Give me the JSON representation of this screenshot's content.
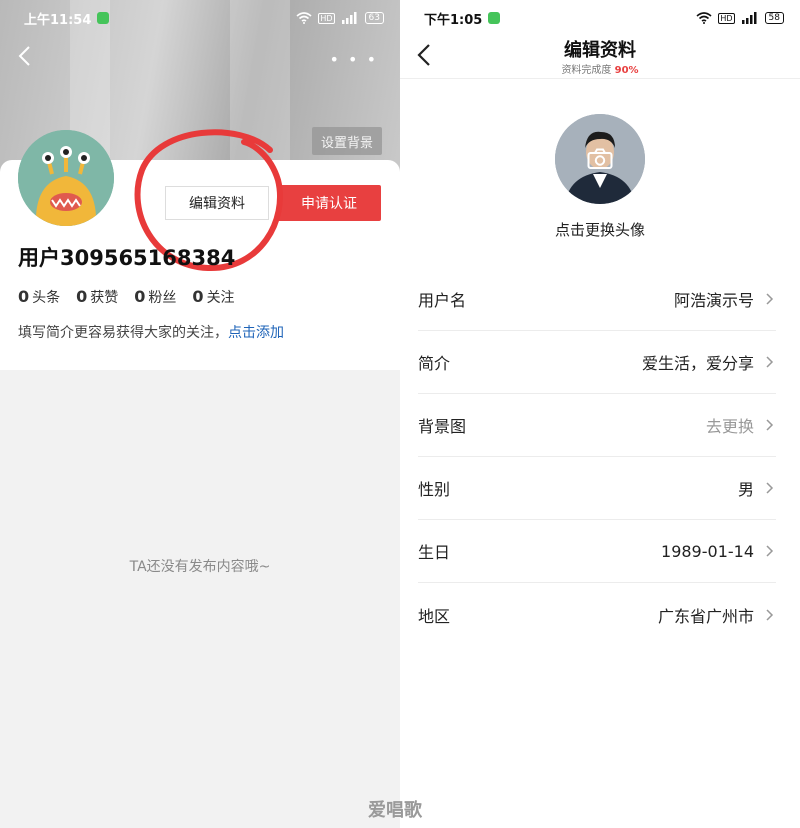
{
  "left": {
    "status": {
      "time": "上午11:54",
      "hd": "HD",
      "battery": "63"
    },
    "set_bg_label": "设置背景",
    "edit_label": "编辑资料",
    "verify_label": "申请认证",
    "username": "用户309565",
    "username_obscured": "168384",
    "stats": [
      {
        "count": "0",
        "label": "头条"
      },
      {
        "count": "0",
        "label": "获赞"
      },
      {
        "count": "0",
        "label": "粉丝"
      },
      {
        "count": "0",
        "label": "关注"
      }
    ],
    "bio_tip": "填写简介更容易获得大家的关注，",
    "bio_link": "点击添加",
    "empty_text": "TA还没有发布内容哦~"
  },
  "right": {
    "status": {
      "time": "下午1:05",
      "hd": "HD",
      "battery": "58"
    },
    "title": "编辑资料",
    "completion_label": "资料完成度",
    "completion_value": "90%",
    "avatar_hint": "点击更换头像",
    "rows": [
      {
        "label": "用户名",
        "value": "阿浩演示号"
      },
      {
        "label": "简介",
        "value": "爱生活，爱分享"
      },
      {
        "label": "背景图",
        "value": "去更换"
      },
      {
        "label": "性别",
        "value": "男"
      },
      {
        "label": "生日",
        "value": "1989-01-14"
      },
      {
        "label": "地区",
        "value": "广东省广州市"
      }
    ]
  },
  "watermark": "爱唱歌",
  "colors": {
    "accent_red": "#e84040",
    "link_blue": "#1f64b8",
    "app_green": "#45c45a"
  }
}
